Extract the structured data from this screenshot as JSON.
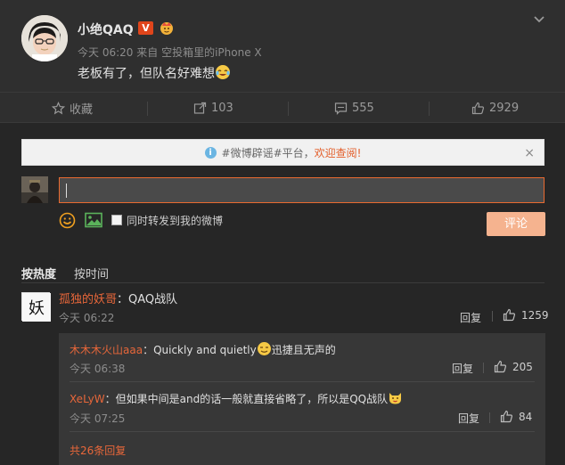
{
  "post": {
    "username": "小绝QAQ",
    "verified_badge": "V",
    "time": "今天 06:20",
    "source_prefix": "来自",
    "source": "空投箱里的iPhone X",
    "content": "老板有了，但队名好难想"
  },
  "actions": {
    "favorite_label": "收藏",
    "repost_count": "103",
    "comment_count": "555",
    "like_count": "2929"
  },
  "notice": {
    "text": "#微博辟谣#平台，",
    "link": "欢迎查阅!",
    "close": "×"
  },
  "composer": {
    "forward_label": "同时转发到我的微博",
    "submit_label": "评论"
  },
  "sort": {
    "by_hot": "按热度",
    "by_time": "按时间"
  },
  "comment": {
    "avatar_text": "妖",
    "nick": "孤独的妖哥",
    "text": "：QAQ战队",
    "time": "今天 06:22",
    "reply": "回复",
    "likes": "1259"
  },
  "replies": [
    {
      "nick": "木木木火山aaa",
      "text_before": "：Quickly and quietly",
      "text_after": "迅捷且无声的",
      "time": "今天 06:38",
      "reply": "回复",
      "likes": "205"
    },
    {
      "nick": "XeLyW",
      "text_before": "：但如果中间是and的话一般就直接省略了，所以是QQ战队",
      "text_after": "",
      "time": "今天 07:25",
      "reply": "回复",
      "likes": "84"
    }
  ],
  "more_replies": "共26条回复",
  "colors": {
    "accent": "#e8673a",
    "input_border": "#e96a30",
    "submit_bg": "#f5b38f"
  }
}
